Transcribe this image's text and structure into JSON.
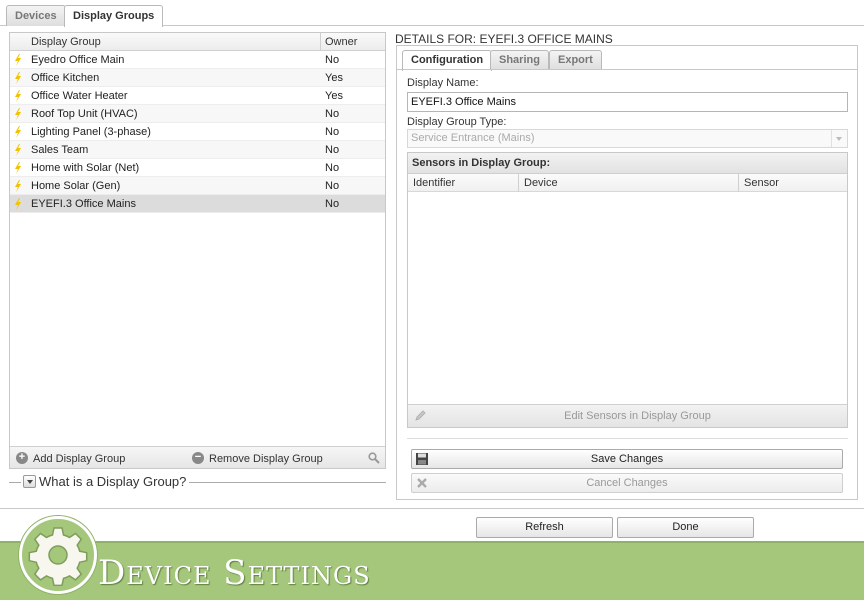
{
  "top_tabs": [
    {
      "label": "Devices",
      "active": false
    },
    {
      "label": "Display Groups",
      "active": true
    }
  ],
  "left": {
    "columns": {
      "name": "Display Group",
      "owner": "Owner"
    },
    "rows": [
      {
        "name": "Eyedro Office Main",
        "owner": "No"
      },
      {
        "name": "Office Kitchen",
        "owner": "Yes"
      },
      {
        "name": "Office Water Heater",
        "owner": "Yes"
      },
      {
        "name": "Roof Top Unit (HVAC)",
        "owner": "No"
      },
      {
        "name": "Lighting Panel (3-phase)",
        "owner": "No"
      },
      {
        "name": "Sales Team",
        "owner": "No"
      },
      {
        "name": "Home with Solar (Net)",
        "owner": "No"
      },
      {
        "name": "Home Solar (Gen)",
        "owner": "No"
      },
      {
        "name": "EYEFI.3 Office Mains",
        "owner": "No",
        "selected": true
      }
    ],
    "add_label": "Add Display Group",
    "remove_label": "Remove Display Group",
    "whatis_label": "What is a Display Group?"
  },
  "details": {
    "title": "DETAILS FOR: EYEFI.3 OFFICE MAINS",
    "tabs": [
      {
        "label": "Configuration",
        "active": true
      },
      {
        "label": "Sharing",
        "active": false
      },
      {
        "label": "Export",
        "active": false
      }
    ],
    "display_name_label": "Display Name:",
    "display_name_value": "EYEFI.3 Office Mains",
    "group_type_label": "Display Group Type:",
    "group_type_value": "Service Entrance (Mains)",
    "sensors_title": "Sensors in Display Group:",
    "sensor_columns": [
      "Identifier",
      "Device",
      "Sensor"
    ],
    "edit_sensors_label": "Edit Sensors in Display Group",
    "save_label": "Save Changes",
    "cancel_label": "Cancel Changes"
  },
  "footer": {
    "refresh_label": "Refresh",
    "done_label": "Done"
  },
  "banner": {
    "title": "Device Settings",
    "icon": "gear-icon"
  },
  "colors": {
    "banner_green": "#a4c77c",
    "bolt_yellow": "#f2c200"
  }
}
